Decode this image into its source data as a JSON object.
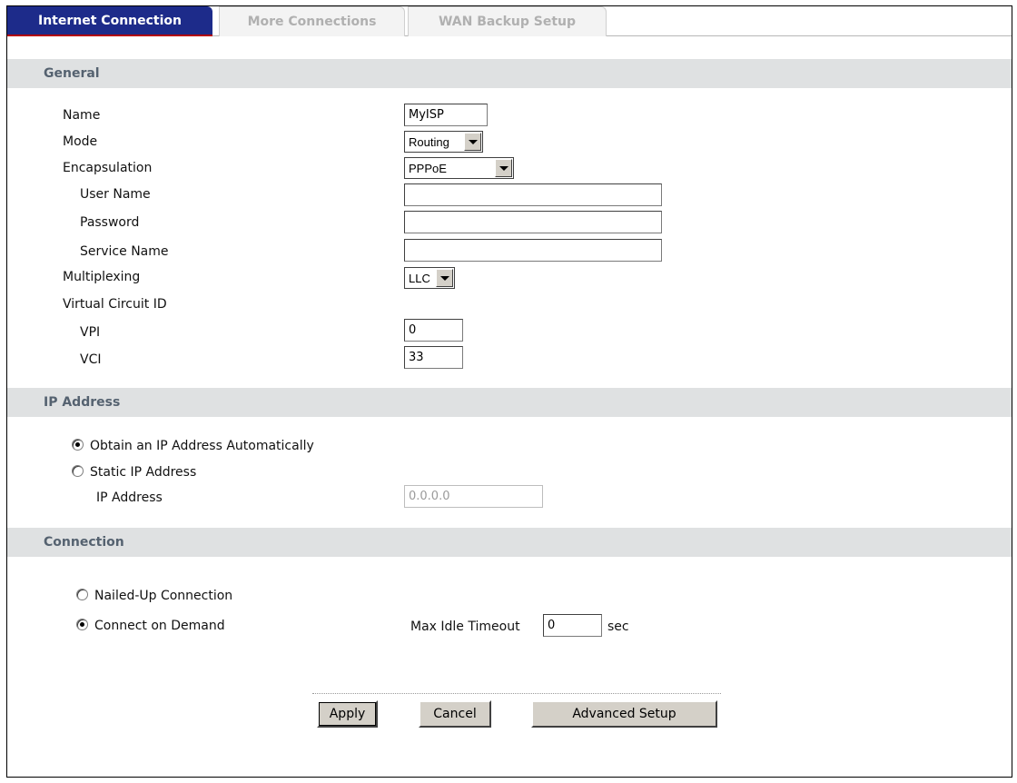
{
  "tabs": [
    {
      "label": "Internet Connection",
      "active": true
    },
    {
      "label": "More Connections",
      "active": false
    },
    {
      "label": "WAN Backup Setup",
      "active": false
    }
  ],
  "general": {
    "title": "General",
    "name_label": "Name",
    "name_value": "MyISP",
    "mode_label": "Mode",
    "mode_value": "Routing",
    "encapsulation_label": "Encapsulation",
    "encapsulation_value": "PPPoE",
    "username_label": "User Name",
    "username_value": "",
    "password_label": "Password",
    "password_value": "",
    "service_label": "Service Name",
    "service_value": "",
    "multiplexing_label": "Multiplexing",
    "multiplexing_value": "LLC",
    "vcid_label": "Virtual Circuit ID",
    "vpi_label": "VPI",
    "vpi_value": "0",
    "vci_label": "VCI",
    "vci_value": "33"
  },
  "ip_address": {
    "title": "IP Address",
    "auto_label": "Obtain an IP Address Automatically",
    "static_label": "Static IP Address",
    "ip_label": "IP Address",
    "ip_value": "0.0.0.0",
    "selected": "auto"
  },
  "connection": {
    "title": "Connection",
    "nailed_label": "Nailed-Up Connection",
    "demand_label": "Connect on Demand",
    "timeout_label": "Max Idle Timeout",
    "timeout_value": "0",
    "timeout_unit": "sec",
    "selected": "demand"
  },
  "buttons": {
    "apply": "Apply",
    "cancel": "Cancel",
    "advanced": "Advanced Setup"
  }
}
